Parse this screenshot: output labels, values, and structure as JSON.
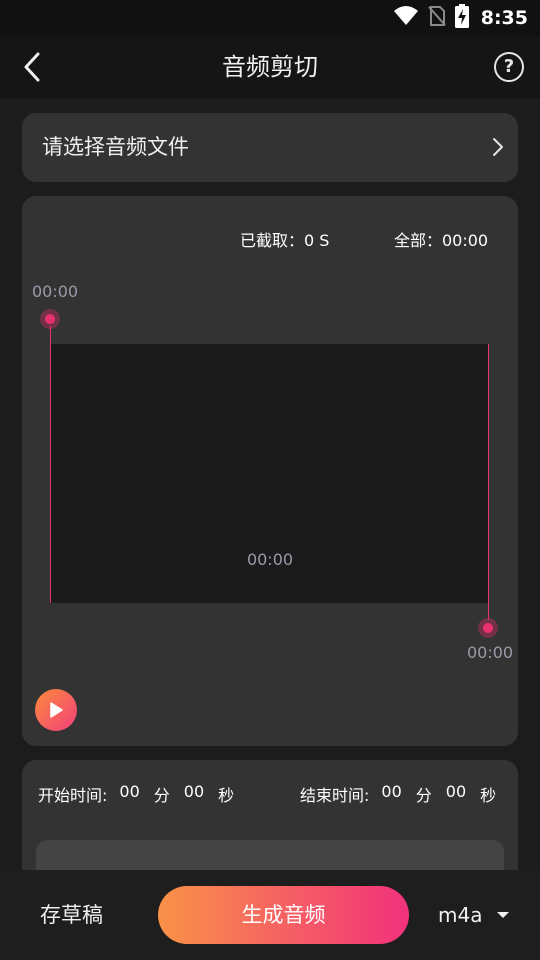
{
  "status_bar": {
    "time": "8:35",
    "icons": [
      "wifi-icon",
      "no-sim-icon",
      "battery-charging-icon"
    ]
  },
  "header": {
    "title": "音频剪切",
    "back_icon": "chevron-left-icon",
    "help_label": "?"
  },
  "file_picker": {
    "label": "请选择音频文件",
    "chevron_icon": "chevron-right-icon"
  },
  "editor": {
    "cut_label": "已截取：0 S",
    "total_label": "全部：00:00",
    "start_time": "00:00",
    "center_time": "00:00",
    "end_time": "00:00",
    "play_icon": "play-icon",
    "accent_color": "#e9326d"
  },
  "time_settings": {
    "start": {
      "label": "开始时间:",
      "minutes": "00",
      "minutes_unit": "分",
      "seconds": "00",
      "seconds_unit": "秒"
    },
    "end": {
      "label": "结束时间:",
      "minutes": "00",
      "minutes_unit": "分",
      "seconds": "00",
      "seconds_unit": "秒"
    }
  },
  "bottom_bar": {
    "draft_label": "存草稿",
    "generate_label": "生成音频",
    "format_value": "m4a",
    "gradient_colors": [
      "#f99248",
      "#f2317c"
    ]
  }
}
